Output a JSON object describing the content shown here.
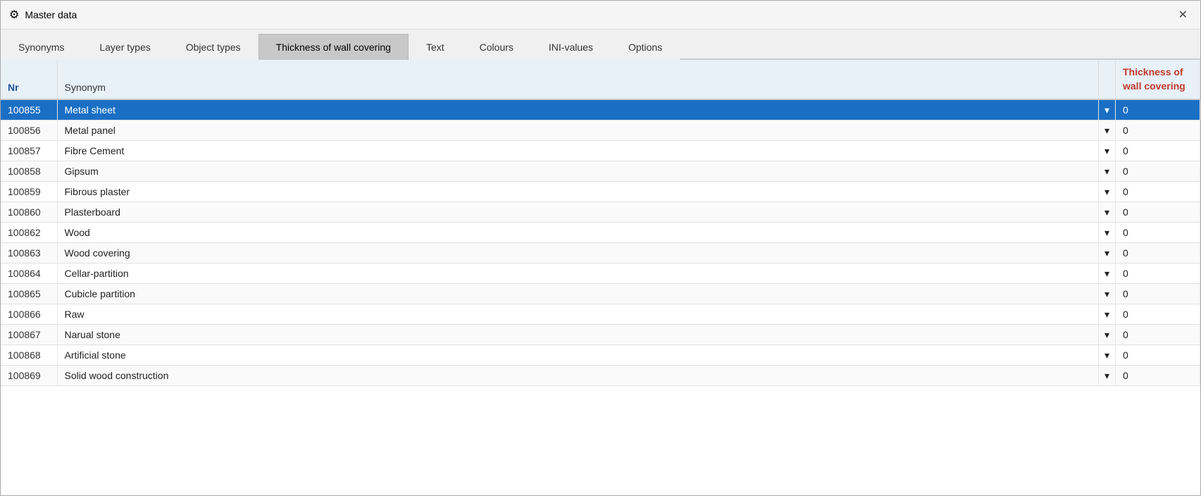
{
  "window": {
    "title": "Master data"
  },
  "tabs": [
    {
      "label": "Synonyms",
      "active": false
    },
    {
      "label": "Layer types",
      "active": false
    },
    {
      "label": "Object types",
      "active": false
    },
    {
      "label": "Thickness of wall covering",
      "active": true
    },
    {
      "label": "Text",
      "active": false
    },
    {
      "label": "Colours",
      "active": false
    },
    {
      "label": "INI-values",
      "active": false
    },
    {
      "label": "Options",
      "active": false
    }
  ],
  "table": {
    "columns": {
      "nr": "Nr",
      "synonym": "Synonym",
      "thickness": "Thickness of wall covering"
    },
    "rows": [
      {
        "nr": "100855",
        "synonym": "Metal sheet",
        "value": "0",
        "selected": true
      },
      {
        "nr": "100856",
        "synonym": "Metal panel",
        "value": "0",
        "selected": false
      },
      {
        "nr": "100857",
        "synonym": "Fibre Cement",
        "value": "0",
        "selected": false
      },
      {
        "nr": "100858",
        "synonym": "Gipsum",
        "value": "0",
        "selected": false
      },
      {
        "nr": "100859",
        "synonym": "Fibrous plaster",
        "value": "0",
        "selected": false
      },
      {
        "nr": "100860",
        "synonym": "Plasterboard",
        "value": "0",
        "selected": false
      },
      {
        "nr": "100862",
        "synonym": "Wood",
        "value": "0",
        "selected": false
      },
      {
        "nr": "100863",
        "synonym": "Wood covering",
        "value": "0",
        "selected": false
      },
      {
        "nr": "100864",
        "synonym": "Cellar-partition",
        "value": "0",
        "selected": false
      },
      {
        "nr": "100865",
        "synonym": "Cubicle partition",
        "value": "0",
        "selected": false
      },
      {
        "nr": "100866",
        "synonym": "Raw",
        "value": "0",
        "selected": false
      },
      {
        "nr": "100867",
        "synonym": "Narual stone",
        "value": "0",
        "selected": false
      },
      {
        "nr": "100868",
        "synonym": "Artificial stone",
        "value": "0",
        "selected": false
      },
      {
        "nr": "100869",
        "synonym": "Solid wood construction",
        "value": "0",
        "selected": false
      }
    ]
  },
  "icons": {
    "close": "✕",
    "gear": "⚙",
    "dropdown": "▾"
  }
}
